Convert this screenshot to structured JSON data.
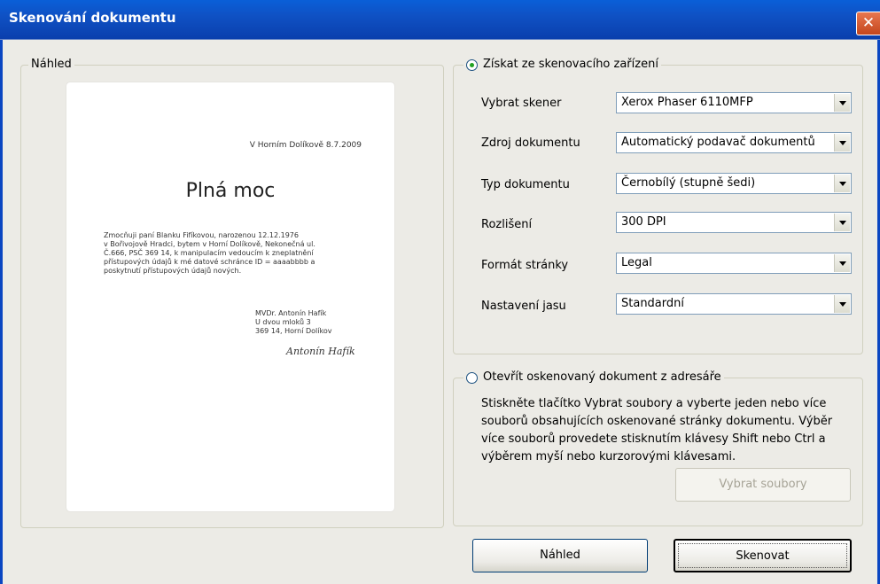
{
  "window": {
    "title": "Skenování dokumentu",
    "close_glyph": "✕"
  },
  "preview": {
    "legend": "Náhled",
    "document": {
      "date": "V Horním Dolíkově 8.7.2009",
      "title": "Plná moc",
      "paragraph": "Zmocňuji paní Blanku Fifíkovou, narozenou 12.12.1976\nv Bořivojově Hradci, bytem v Horní Dolíkově, Nekonečná ul.\nČ.666, PSČ 369 14, k manipulacím vedoucím k zneplatnění\npřístupových údajů k mé datové schránce ID = aaaabbbb a\nposkytnutí přístupových údajů nových.",
      "address": "MVDr. Antonín Hafík\nU dvou mloků 3\n369 14, Horní Dolíkov",
      "signature": "Antonín Hafík"
    }
  },
  "scanner_group": {
    "radio_label": "Získat ze skenovacího zařízení",
    "selected": true,
    "fields": [
      {
        "label": "Vybrat skener",
        "value": "Xerox Phaser 6110MFP"
      },
      {
        "label": "Zdroj dokumentu",
        "value": "Automatický podavač dokumentů"
      },
      {
        "label": "Typ dokumentu",
        "value": "Černobílý (stupně šedi)"
      },
      {
        "label": "Rozlišení",
        "value": "300 DPI"
      },
      {
        "label": "Formát stránky",
        "value": "Legal"
      },
      {
        "label": "Nastavení jasu",
        "value": "Standardní"
      }
    ]
  },
  "folder_group": {
    "radio_label": "Otevřít oskenovaný dokument z adresáře",
    "selected": false,
    "description": "Stiskněte tlačítko Vybrat soubory a vyberte jeden nebo více souborů obsahujících oskenované stránky dokumentu. Výběr více souborů provedete stisknutím klávesy Shift nebo Ctrl a výběrem myší nebo kurzorovými klávesami.",
    "select_files_button": "Vybrat soubory"
  },
  "buttons": {
    "preview": "Náhled",
    "scan": "Skenovat"
  }
}
